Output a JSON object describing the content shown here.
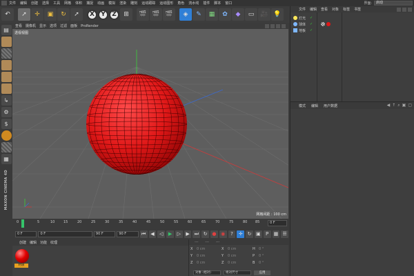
{
  "menubar": {
    "items": [
      "文件",
      "编辑",
      "创建",
      "选择",
      "工具",
      "网格",
      "体积",
      "捕捉",
      "动画",
      "模拟",
      "渲染",
      "雕刻",
      "运动跟踪",
      "运动图形",
      "角色",
      "流水线",
      "插件",
      "脚本",
      "窗口"
    ],
    "layout_label": "界面:",
    "layout_value": "启动"
  },
  "toolbar": {
    "axis_x": "X",
    "axis_y": "Y",
    "axis_z": "Z"
  },
  "viewport": {
    "menu": [
      "查看",
      "摄像机",
      "显示",
      "选项",
      "过滤",
      "面板",
      "ProRender"
    ],
    "title": "透视视图",
    "grid_distance": "网格间距 : 100 cm"
  },
  "timeline": {
    "ticks": [
      "0",
      "5",
      "10",
      "15",
      "20",
      "25",
      "30",
      "35",
      "40",
      "45",
      "50",
      "55",
      "60",
      "65",
      "70",
      "75",
      "80",
      "85",
      "90"
    ],
    "current_frame": "0 F"
  },
  "transport": {
    "start_frame": "0 F",
    "min_frame": "0 F",
    "max_frame": "90 F",
    "end_frame": "90 F"
  },
  "material_manager": {
    "menu": [
      "创建",
      "编辑",
      "功能",
      "纹理"
    ],
    "material_name": "材质"
  },
  "coordinates": {
    "headers": [
      "---",
      "---",
      "---"
    ],
    "rows": [
      {
        "a": "X",
        "av": "0 cm",
        "b": "X",
        "bv": "0 cm",
        "c": "H",
        "cv": "0 °"
      },
      {
        "a": "Y",
        "av": "0 cm",
        "b": "Y",
        "bv": "0 cm",
        "c": "P",
        "cv": "0 °"
      },
      {
        "a": "Z",
        "av": "0 cm",
        "b": "Z",
        "bv": "0 cm",
        "c": "B",
        "cv": "0 °"
      }
    ],
    "mode": "对象 (相对)",
    "size_mode": "绝对尺寸",
    "apply": "应用"
  },
  "object_manager": {
    "menu": [
      "文件",
      "编辑",
      "查看",
      "对象",
      "标签",
      "书签"
    ],
    "objects": [
      {
        "name": "灯光",
        "color": "#ffe85a"
      },
      {
        "name": "球体",
        "color": "#7fb8ff"
      },
      {
        "name": "地板",
        "color": "#7fb8ff"
      }
    ]
  },
  "attribute_manager": {
    "menu": [
      "模式",
      "编辑",
      "用户数据"
    ]
  },
  "colors": {
    "sphere": "#e01818",
    "accent": "#2f7fd6",
    "playhead": "#35c46a"
  },
  "brand": "MAXON CINEMA 4D"
}
